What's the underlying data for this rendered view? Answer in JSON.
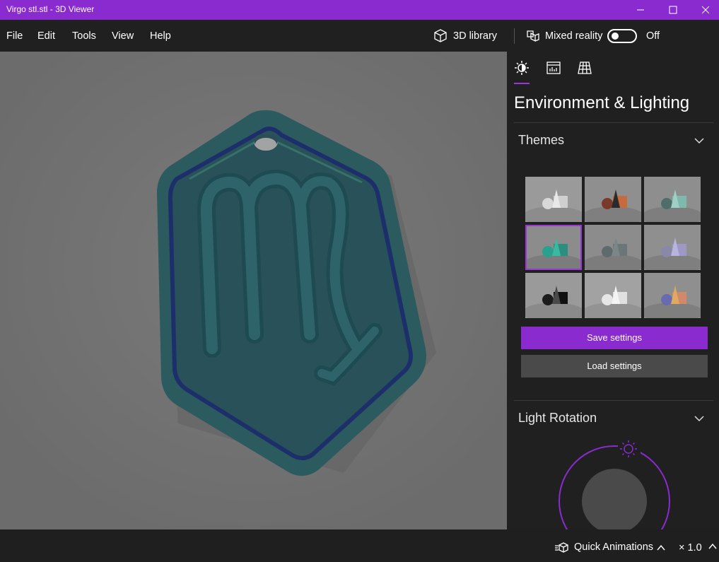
{
  "window": {
    "title": "Virgo stl.stl - 3D Viewer",
    "controls": [
      "minimize",
      "maximize",
      "close"
    ]
  },
  "menu": {
    "items": [
      "File",
      "Edit",
      "Tools",
      "View",
      "Help"
    ],
    "library_label": "3D library",
    "mixed_reality_label": "Mixed reality",
    "mixed_reality_state": "Off"
  },
  "panel": {
    "tabs": [
      "environment-lighting",
      "stats-shading",
      "grid-views"
    ],
    "active_tab": 0,
    "title": "Environment & Lighting",
    "themes_section": "Themes",
    "themes": [
      {
        "name": "white",
        "selected": false
      },
      {
        "name": "dark-orange",
        "selected": false
      },
      {
        "name": "teal-soft",
        "selected": false
      },
      {
        "name": "teal",
        "selected": true
      },
      {
        "name": "gray",
        "selected": false
      },
      {
        "name": "lavender",
        "selected": false
      },
      {
        "name": "black",
        "selected": false
      },
      {
        "name": "bright-white",
        "selected": false
      },
      {
        "name": "warm-gold",
        "selected": false
      }
    ],
    "save_label": "Save settings",
    "load_label": "Load settings",
    "light_section": "Light Rotation"
  },
  "bottom": {
    "animations_label": "Quick Animations",
    "speed": "× 1.0"
  },
  "colors": {
    "accent": "#8a2bd0",
    "model": "#2b5a5f",
    "viewport_bg": "#737373"
  }
}
